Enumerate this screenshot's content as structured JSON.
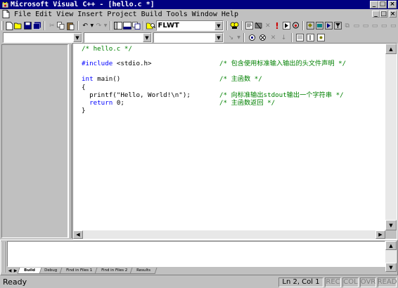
{
  "window": {
    "title": "Microsoft Visual C++ - [hello.c *]",
    "controls": {
      "minimize": "_",
      "maximize": "□",
      "close": "×"
    }
  },
  "menu": {
    "items": [
      "File",
      "Edit",
      "View",
      "Insert",
      "Project",
      "Build",
      "Tools",
      "Window",
      "Help"
    ]
  },
  "toolbar": {
    "find_combo_value": "FLWT",
    "class_combo_value": "",
    "members_combo_value": "",
    "function_combo_value": ""
  },
  "editor": {
    "lines": [
      {
        "code": "/* hello.c */",
        "comment": "",
        "style": "comment"
      },
      {
        "code": "",
        "comment": "",
        "style": "plain"
      },
      {
        "code": "#include <stdio.h>",
        "comment": "/* 包含使用标准输入输出的头文件声明 */",
        "style": "keyword"
      },
      {
        "code": "",
        "comment": "",
        "style": "plain"
      },
      {
        "code": "int main()",
        "comment": "/* 主函数 */",
        "style": "keyword"
      },
      {
        "code": "{",
        "comment": "",
        "style": "plain"
      },
      {
        "code": "  printf(\"Hello, World!\\n\");",
        "comment": "/* 向标准输出stdout输出一个字符串 */",
        "style": "plain"
      },
      {
        "code": "  return 0;",
        "comment": "/* 主函数返回 */",
        "style": "keyword"
      },
      {
        "code": "}",
        "comment": "",
        "style": "plain"
      }
    ]
  },
  "output": {
    "tabs": [
      "Build",
      "Debug",
      "Find in Files 1",
      "Find in Files 2",
      "Results"
    ],
    "active_tab": 0
  },
  "status": {
    "message": "Ready",
    "position": "Ln 2, Col 1",
    "indicators": [
      "REC",
      "COL",
      "OVR",
      "READ"
    ]
  }
}
